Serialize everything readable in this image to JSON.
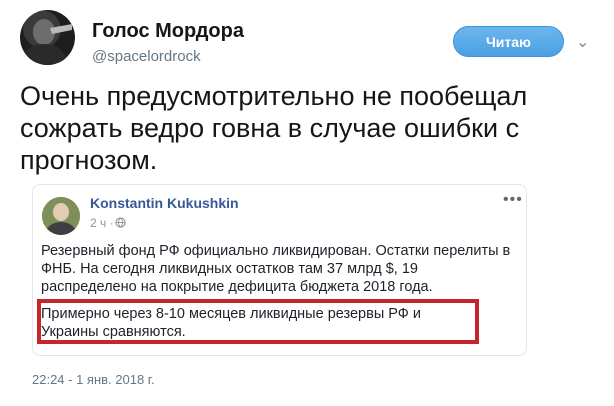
{
  "author": {
    "name": "Голос Мордора",
    "handle": "@spacelordrock"
  },
  "follow_button": {
    "label": "Читаю",
    "color": "#4aa0e3"
  },
  "menu_icon": "chevron-down-icon",
  "tweet": {
    "text": "Очень предусмотрительно не пообещал сожрать ведро говна в случае ошибки с прогнозом.",
    "timestamp": "22:24 - 1 янв. 2018 г."
  },
  "embedded_post": {
    "author": "Konstantin Kukushkin",
    "time": "2 ч ·",
    "privacy_icon": "globe-icon",
    "options_icon": "more-dots-icon",
    "body": "Резервный фонд РФ официально ликвидирован. Остатки перелиты в ФНБ. На сегодня ликвидных остатков там 37 млрд $, 19 распределено на покрытие дефицита бюджета 2018 года.",
    "highlighted": "Примерно через 8-10 месяцев ликвидные резервы РФ и Украины сравняются.",
    "highlight_color": "#c5262b"
  }
}
